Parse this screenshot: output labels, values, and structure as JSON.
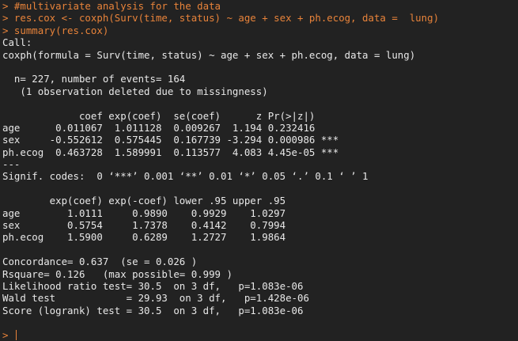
{
  "console": {
    "commands": [
      "> #multivariate analysis for the data",
      "> res.cox <- coxph(Surv(time, status) ~ age + sex + ph.ecog, data =  lung)",
      "> summary(res.cox)"
    ],
    "output": [
      "Call:",
      "coxph(formula = Surv(time, status) ~ age + sex + ph.ecog, data = lung)",
      "",
      "  n= 227, number of events= 164 ",
      "   (1 observation deleted due to missingness)",
      "",
      "             coef exp(coef)  se(coef)      z Pr(>|z|)    ",
      "age      0.011067  1.011128  0.009267  1.194 0.232416    ",
      "sex     -0.552612  0.575445  0.167739 -3.294 0.000986 ***",
      "ph.ecog  0.463728  1.589991  0.113577  4.083 4.45e-05 ***",
      "---",
      "Signif. codes:  0 ‘***’ 0.001 ‘**’ 0.01 ‘*’ 0.05 ‘.’ 0.1 ‘ ’ 1",
      "",
      "        exp(coef) exp(-coef) lower .95 upper .95",
      "age        1.0111     0.9890    0.9929    1.0297",
      "sex        0.5754     1.7378    0.4142    0.7994",
      "ph.ecog    1.5900     0.6289    1.2727    1.9864",
      "",
      "Concordance= 0.637  (se = 0.026 )",
      "Rsquare= 0.126   (max possible= 0.999 )",
      "Likelihood ratio test= 30.5  on 3 df,   p=1.083e-06",
      "Wald test            = 29.93  on 3 df,   p=1.428e-06",
      "Score (logrank) test = 30.5  on 3 df,   p=1.083e-06",
      ""
    ],
    "prompt": "> "
  },
  "colors": {
    "background": "#222222",
    "command_text": "#e8833a",
    "output_text": "#e8e8e8"
  }
}
